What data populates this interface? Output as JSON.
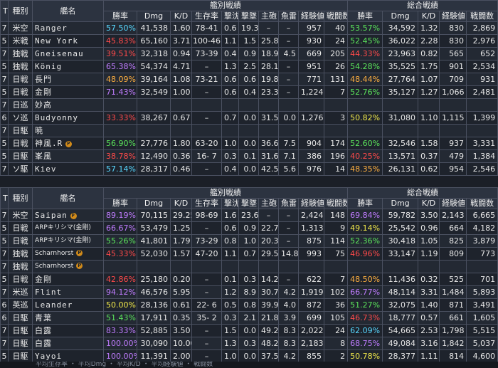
{
  "headers": {
    "t": "T",
    "class": "種別",
    "name": "艦名",
    "ship_group": "艦別戦績",
    "total_group": "総合戦績",
    "win": "勝率",
    "dmg": "Dmg",
    "kd": "K/D",
    "surv": "生存率",
    "plane": "撃沈",
    "planes": "撃墜",
    "main": "主砲",
    "torp": "魚雷",
    "exp": "経験値",
    "battles": "戦闘数"
  },
  "colors": {
    "green": "#5be35b",
    "red": "#ff4a4a",
    "purple": "#c07cff",
    "cyan": "#58d8ff",
    "yellow": "#f0e84a",
    "orange": "#ffb040",
    "white": "#e8e8e8"
  },
  "team1": [
    {
      "t": "7",
      "cls": "米空",
      "name": "Ranger",
      "win": "57.50%",
      "wc": "cyan",
      "dmg": "41,538",
      "kd": "1.60",
      "surv": "78-41",
      "kill": "0.6",
      "pl": "19.3",
      "main": "–",
      "torp": "–",
      "exp": "957",
      "btl": "40",
      "twin": "53.57%",
      "twc": "green",
      "tdmg": "34,592",
      "tkd": "1.32",
      "texp": "830",
      "tbtl": "2,869"
    },
    {
      "t": "5",
      "cls": "米戦",
      "name": "New York",
      "small": false,
      "win": "45.83%",
      "wc": "red",
      "dmg": "65,160",
      "kd": "3.71",
      "surv": "100-46",
      "kill": "1.1",
      "pl": "1.5",
      "main": "25.8",
      "torp": "–",
      "exp": "930",
      "btl": "24",
      "twin": "52.45%",
      "twc": "green",
      "tdmg": "36,022",
      "tkd": "2.28",
      "texp": "830",
      "tbtl": "2,976"
    },
    {
      "t": "7",
      "cls": "独戦",
      "name": "Gneisenau",
      "small": false,
      "win": "39.51%",
      "wc": "red",
      "dmg": "32,318",
      "kd": "0.94",
      "surv": "73-39",
      "kill": "0.4",
      "pl": "0.9",
      "main": "18.9",
      "torp": "4.5",
      "exp": "669",
      "btl": "205",
      "twin": "44.33%",
      "twc": "red",
      "tdmg": "23,963",
      "tkd": "0.82",
      "texp": "565",
      "tbtl": "652"
    },
    {
      "t": "5",
      "cls": "独戦",
      "name": "König",
      "win": "65.38%",
      "wc": "purple",
      "dmg": "54,374",
      "kd": "4.71",
      "surv": "–",
      "kill": "1.3",
      "pl": "2.5",
      "main": "28.1",
      "torp": "–",
      "exp": "951",
      "btl": "26",
      "twin": "54.28%",
      "twc": "green",
      "tdmg": "35,525",
      "tkd": "1.75",
      "texp": "901",
      "tbtl": "2,534"
    },
    {
      "t": "7",
      "cls": "日戦",
      "name": "長門",
      "win": "48.09%",
      "wc": "orange",
      "dmg": "39,164",
      "kd": "1.08",
      "surv": "73-21",
      "kill": "0.6",
      "pl": "0.6",
      "main": "19.8",
      "torp": "–",
      "exp": "771",
      "btl": "131",
      "twin": "48.44%",
      "twc": "orange",
      "tdmg": "27,764",
      "tkd": "1.07",
      "texp": "709",
      "tbtl": "931"
    },
    {
      "t": "5",
      "cls": "日戦",
      "name": "金剛",
      "win": "71.43%",
      "wc": "purple",
      "dmg": "32,549",
      "kd": "1.00",
      "surv": "–",
      "kill": "0.6",
      "pl": "0.4",
      "main": "23.3",
      "torp": "–",
      "exp": "1,224",
      "btl": "7",
      "twin": "52.76%",
      "twc": "green",
      "tdmg": "35,127",
      "tkd": "1.27",
      "texp": "1,066",
      "tbtl": "2,481"
    },
    {
      "t": "7",
      "cls": "日巡",
      "name": "妙高",
      "win": "",
      "wc": "white",
      "dmg": "",
      "kd": "",
      "surv": "",
      "kill": "",
      "pl": "",
      "main": "",
      "torp": "",
      "exp": "",
      "btl": "",
      "twin": "",
      "twc": "white",
      "tdmg": "",
      "tkd": "",
      "texp": "",
      "tbtl": ""
    },
    {
      "t": "6",
      "cls": "ソ巡",
      "name": "Budyonny",
      "win": "33.33%",
      "wc": "red",
      "dmg": "38,267",
      "kd": "0.67",
      "surv": "–",
      "kill": "0.7",
      "pl": "0.0",
      "main": "31.5",
      "torp": "0.0",
      "exp": "1,276",
      "btl": "3",
      "twin": "50.82%",
      "twc": "yellow",
      "tdmg": "31,080",
      "tkd": "1.10",
      "texp": "1,115",
      "tbtl": "1,399"
    },
    {
      "t": "7",
      "cls": "日駆",
      "name": "暁",
      "win": "",
      "wc": "white",
      "dmg": "",
      "kd": "",
      "surv": "",
      "kill": "",
      "pl": "",
      "main": "",
      "torp": "",
      "exp": "",
      "btl": "",
      "twin": "",
      "twc": "white",
      "tdmg": "",
      "tkd": "",
      "texp": "",
      "tbtl": ""
    },
    {
      "t": "5",
      "cls": "日戦",
      "name": "神風.R",
      "badge": "P",
      "win": "56.90%",
      "wc": "green",
      "dmg": "27,776",
      "kd": "1.80",
      "surv": "63-20",
      "kill": "1.0",
      "pl": "0.0",
      "main": "36.6",
      "torp": "7.5",
      "exp": "904",
      "btl": "174",
      "twin": "52.60%",
      "twc": "green",
      "tdmg": "32,546",
      "tkd": "1.58",
      "texp": "937",
      "tbtl": "3,331"
    },
    {
      "t": "5",
      "cls": "日駆",
      "name": "峯風",
      "win": "38.78%",
      "wc": "red",
      "dmg": "12,490",
      "kd": "0.36",
      "surv": "16- 7",
      "kill": "0.3",
      "pl": "0.1",
      "main": "31.6",
      "torp": "7.1",
      "exp": "386",
      "btl": "196",
      "twin": "40.25%",
      "twc": "red",
      "tdmg": "13,571",
      "tkd": "0.37",
      "texp": "479",
      "tbtl": "1,384"
    },
    {
      "t": "7",
      "cls": "ソ駆",
      "name": "Kiev",
      "win": "57.14%",
      "wc": "cyan",
      "dmg": "28,317",
      "kd": "0.46",
      "surv": "–",
      "kill": "0.4",
      "pl": "0.0",
      "main": "42.5",
      "torp": "5.6",
      "exp": "976",
      "btl": "14",
      "twin": "48.35%",
      "twc": "orange",
      "tdmg": "26,131",
      "tkd": "0.62",
      "texp": "954",
      "tbtl": "2,546"
    }
  ],
  "team2": [
    {
      "t": "7",
      "cls": "米空",
      "name": "Saipan",
      "badge": "P",
      "win": "89.19%",
      "wc": "purple",
      "dmg": "70,115",
      "kd": "29.25",
      "surv": "98-69",
      "kill": "1.6",
      "pl": "23.6",
      "main": "–",
      "torp": "–",
      "exp": "2,424",
      "btl": "148",
      "twin": "69.84%",
      "twc": "purple",
      "tdmg": "59,782",
      "tkd": "3.50",
      "texp": "2,143",
      "tbtl": "6,665"
    },
    {
      "t": "5",
      "cls": "日戦",
      "name": "ARPキリシマ(金剛)",
      "small": true,
      "win": "66.67%",
      "wc": "purple",
      "dmg": "53,479",
      "kd": "1.25",
      "surv": "–",
      "kill": "0.6",
      "pl": "0.9",
      "main": "22.7",
      "torp": "–",
      "exp": "1,313",
      "btl": "9",
      "twin": "49.14%",
      "twc": "yellow",
      "tdmg": "25,542",
      "tkd": "0.96",
      "texp": "664",
      "tbtl": "4,182"
    },
    {
      "t": "5",
      "cls": "日戦",
      "name": "ARPキリシマ(金剛)",
      "small": true,
      "win": "55.26%",
      "wc": "green",
      "dmg": "41,801",
      "kd": "1.79",
      "surv": "73-29",
      "kill": "0.8",
      "pl": "1.0",
      "main": "20.3",
      "torp": "–",
      "exp": "875",
      "btl": "114",
      "twin": "52.36%",
      "twc": "green",
      "tdmg": "30,418",
      "tkd": "1.05",
      "texp": "825",
      "tbtl": "3,879"
    },
    {
      "t": "7",
      "cls": "独戦",
      "name": "Scharnhorst",
      "badge": "P",
      "small": true,
      "win": "45.33%",
      "wc": "red",
      "dmg": "52,030",
      "kd": "1.57",
      "surv": "47-20",
      "kill": "1.1",
      "pl": "0.7",
      "main": "29.5",
      "torp": "14.8",
      "exp": "993",
      "btl": "75",
      "twin": "46.96%",
      "twc": "red",
      "tdmg": "33,147",
      "tkd": "1.19",
      "texp": "809",
      "tbtl": "773"
    },
    {
      "t": "7",
      "cls": "独戦",
      "name": "Scharnhorst",
      "badge": "P",
      "small": true,
      "win": "",
      "wc": "white",
      "dmg": "",
      "kd": "",
      "surv": "",
      "kill": "",
      "pl": "",
      "main": "",
      "torp": "",
      "exp": "",
      "btl": "",
      "twin": "",
      "twc": "white",
      "tdmg": "",
      "tkd": "",
      "texp": "",
      "tbtl": ""
    },
    {
      "t": "5",
      "cls": "日戦",
      "name": "金剛",
      "win": "42.86%",
      "wc": "red",
      "dmg": "25,180",
      "kd": "0.20",
      "surv": "–",
      "kill": "0.1",
      "pl": "0.3",
      "main": "14.2",
      "torp": "–",
      "exp": "622",
      "btl": "7",
      "twin": "48.50%",
      "twc": "orange",
      "tdmg": "11,436",
      "tkd": "0.32",
      "texp": "525",
      "tbtl": "701"
    },
    {
      "t": "7",
      "cls": "米巡",
      "name": "Flint",
      "win": "94.12%",
      "wc": "purple",
      "dmg": "46,576",
      "kd": "5.95",
      "surv": "–",
      "kill": "1.2",
      "pl": "8.9",
      "main": "30.7",
      "torp": "4.2",
      "exp": "1,919",
      "btl": "102",
      "twin": "66.77%",
      "twc": "purple",
      "tdmg": "48,114",
      "tkd": "3.31",
      "texp": "1,484",
      "tbtl": "5,893"
    },
    {
      "t": "6",
      "cls": "英巡",
      "name": "Leander",
      "win": "50.00%",
      "wc": "yellow",
      "dmg": "28,136",
      "kd": "0.61",
      "surv": "22- 6",
      "kill": "0.5",
      "pl": "0.8",
      "main": "39.9",
      "torp": "4.0",
      "exp": "872",
      "btl": "36",
      "twin": "51.27%",
      "twc": "green",
      "tdmg": "32,075",
      "tkd": "1.40",
      "texp": "871",
      "tbtl": "3,491"
    },
    {
      "t": "6",
      "cls": "日駆",
      "name": "青葉",
      "win": "51.43%",
      "wc": "green",
      "dmg": "17,911",
      "kd": "0.35",
      "surv": "35- 2",
      "kill": "0.3",
      "pl": "2.1",
      "main": "21.8",
      "torp": "3.9",
      "exp": "699",
      "btl": "105",
      "twin": "46.73%",
      "twc": "red",
      "tdmg": "18,777",
      "tkd": "0.57",
      "texp": "661",
      "tbtl": "1,605"
    },
    {
      "t": "7",
      "cls": "日駆",
      "name": "白露",
      "win": "83.33%",
      "wc": "purple",
      "dmg": "52,885",
      "kd": "3.50",
      "surv": "–",
      "kill": "1.5",
      "pl": "0.0",
      "main": "49.2",
      "torp": "8.3",
      "exp": "2,022",
      "btl": "24",
      "twin": "62.09%",
      "twc": "cyan",
      "tdmg": "54,665",
      "tkd": "2.53",
      "texp": "1,798",
      "tbtl": "5,515"
    },
    {
      "t": "7",
      "cls": "日駆",
      "name": "白露",
      "win": "100.00%",
      "wc": "purple",
      "dmg": "30,090",
      "kd": "10.00",
      "surv": "–",
      "kill": "1.3",
      "pl": "0.3",
      "main": "48.2",
      "torp": "8.3",
      "exp": "2,183",
      "btl": "8",
      "twin": "68.75%",
      "twc": "purple",
      "tdmg": "49,084",
      "tkd": "3.16",
      "texp": "1,842",
      "tbtl": "5,037"
    },
    {
      "t": "5",
      "cls": "日駆",
      "name": "Yayoi",
      "win": "100.00%",
      "wc": "purple",
      "dmg": "11,391",
      "kd": "2.00",
      "surv": "–",
      "kill": "1.0",
      "pl": "0.0",
      "main": "37.5",
      "torp": "4.2",
      "exp": "855",
      "btl": "2",
      "twin": "50.78%",
      "twc": "yellow",
      "tdmg": "28,377",
      "tkd": "1.11",
      "texp": "814",
      "tbtl": "4,600"
    }
  ],
  "footer": "平均生存率 ・ 平均Dmg ・ 平均K/D ・ 平均経験値 ・ 戦闘数"
}
